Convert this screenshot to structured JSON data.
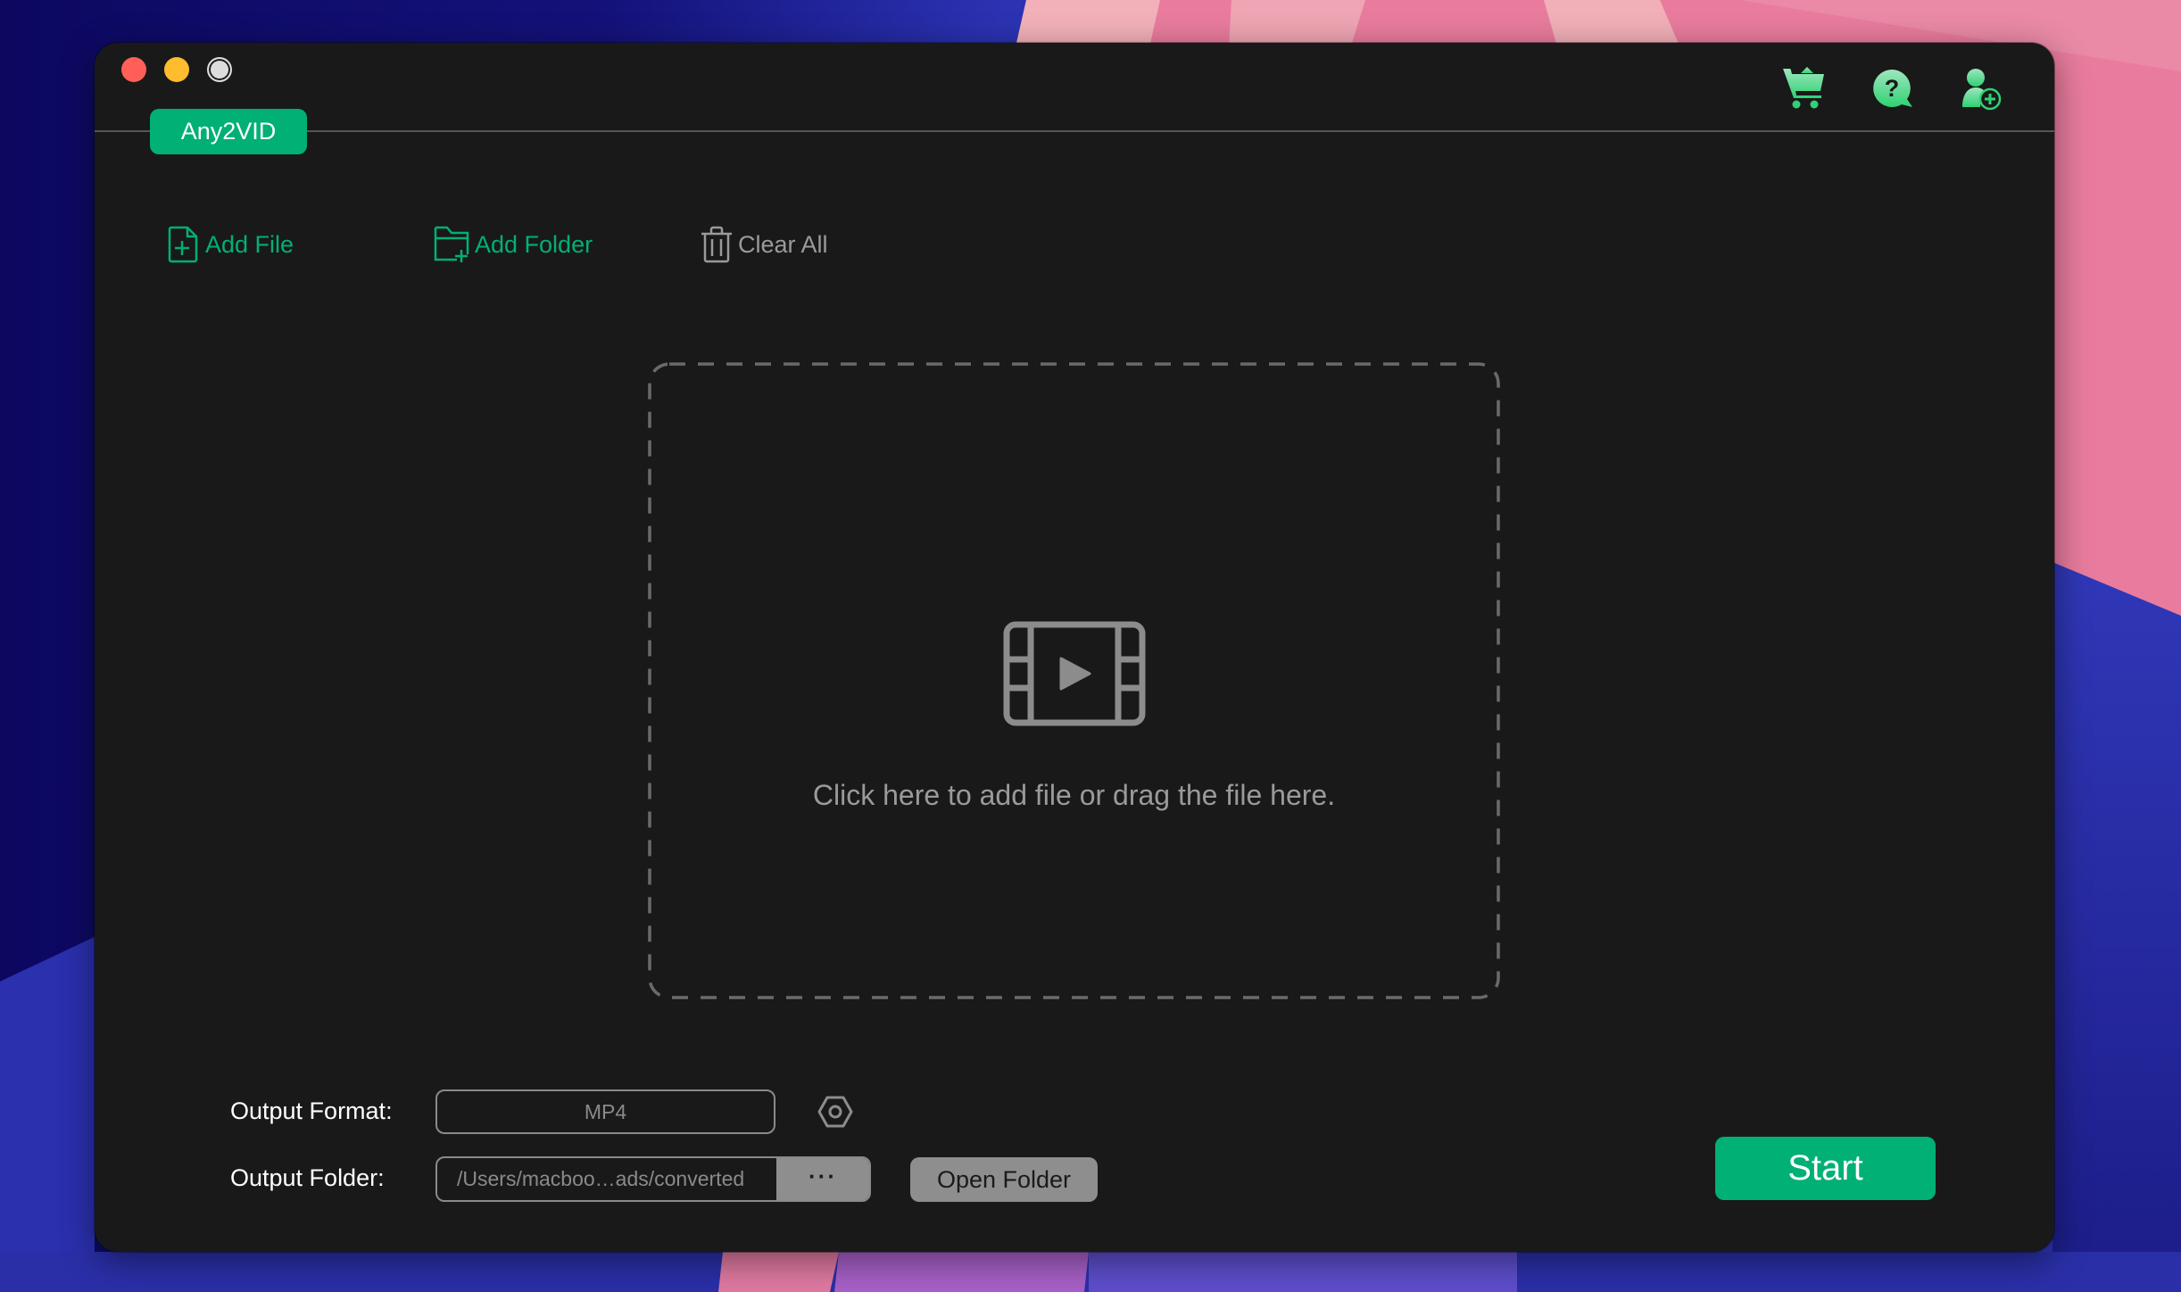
{
  "window": {
    "app_tab_label": "Any2VID",
    "traffic_lights": [
      "close",
      "minimize",
      "zoom"
    ]
  },
  "header_icons": [
    {
      "name": "cart-icon",
      "label": "Buy"
    },
    {
      "name": "help-icon",
      "label": "Help"
    },
    {
      "name": "account-icon",
      "label": "Register"
    }
  ],
  "toolbar": {
    "add_file": "Add File",
    "add_folder": "Add Folder",
    "clear_all": "Clear All"
  },
  "dropzone": {
    "icon": "video-film-icon",
    "text": "Click here to add file or drag the file here."
  },
  "output": {
    "format_label": "Output Format:",
    "format_value": "MP4",
    "folder_label": "Output Folder:",
    "folder_value": "/Users/macboo…ads/converted",
    "browse_label": "···",
    "open_folder_label": "Open Folder"
  },
  "start_label": "Start",
  "colors": {
    "accent": "#00b075",
    "window_bg": "#191919",
    "muted": "#8e8e8e"
  }
}
